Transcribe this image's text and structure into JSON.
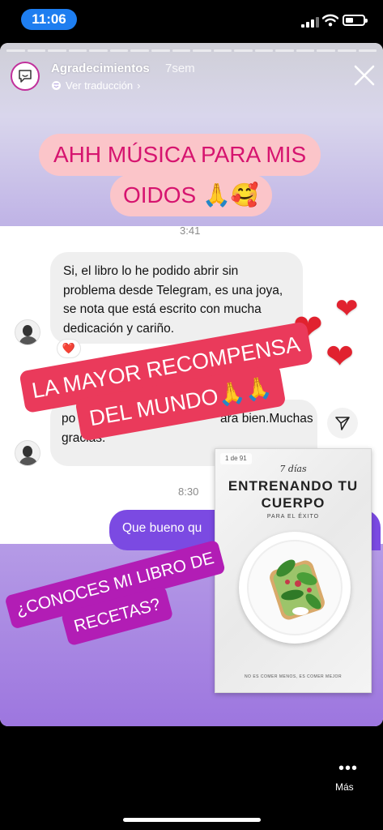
{
  "status_bar": {
    "time": "11:06",
    "signal_icon": "cellular-signal-icon",
    "wifi_icon": "wifi-icon",
    "battery_icon": "battery-icon",
    "battery_level": 0.3
  },
  "story": {
    "progress_segments": 18,
    "account": {
      "name": "Agradecimientos",
      "age": "7sem",
      "translate_label": "Ver traducción",
      "translate_chevron": "›"
    },
    "banner_top": {
      "line1": "AHH MÚSICA PARA MIS",
      "line2": "OIDOS 🙏🥰"
    },
    "chat": {
      "timestamp_1": "3:41",
      "message_1": "Si, el libro lo he podido abrir sin problema desde Telegram, es una joya, se nota que está escrito con mucha dedicación y cariño.",
      "reaction": "❤️",
      "message_2_visible": "po",
      "message_2_tail": "ara bien.Muchas",
      "message_2_end": "gracias.",
      "timestamp_2": "8:30",
      "message_out": "Que bueno qu"
    },
    "banner_middle": {
      "line1": "LA MAYOR RECOMPENSA",
      "line2": "DEL MUNDO🙏🙏"
    },
    "book": {
      "page_indicator": "1 de 91",
      "script_text": "7 días",
      "title_line1": "ENTRENANDO TU",
      "title_line2": "CUERPO",
      "subtitle": "PARA EL ÉXITO",
      "footer": "NO ES COMER MENOS, ES COMER MEJOR"
    },
    "banner_bottom": {
      "line1": "¿CONOCES MI LIBRO DE",
      "line2": "RECETAS?"
    },
    "hearts": [
      "❤",
      "❤",
      "❤"
    ]
  },
  "bottom": {
    "more_icon": "•••",
    "more_label": "Más"
  },
  "colors": {
    "pink_sticker_bg": "#fbc5c9",
    "pink_sticker_text": "#d6146f",
    "red_sticker": "#ea3a5b",
    "purple_sticker": "#b21db5",
    "outgoing_bubble": "#7b4ae2",
    "time_pill": "#1e7ef0"
  }
}
